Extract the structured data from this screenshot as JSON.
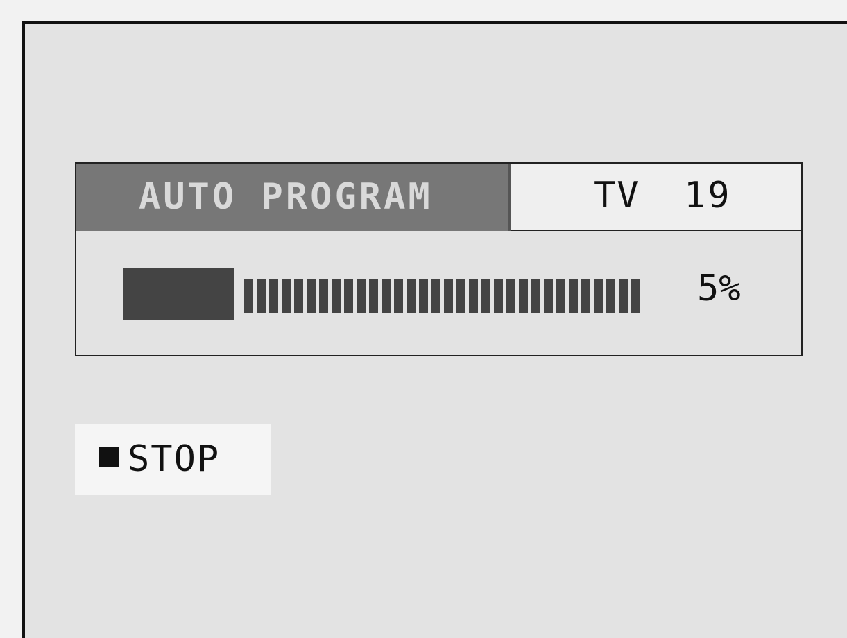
{
  "screen": {
    "title": "AUTO PROGRAM",
    "channel": {
      "band": "TV",
      "number": "19"
    },
    "progress": {
      "percent_value": 0.05,
      "percent_text": "5%"
    },
    "stop": {
      "icon": "stop-square-icon",
      "label": "STOP"
    }
  }
}
